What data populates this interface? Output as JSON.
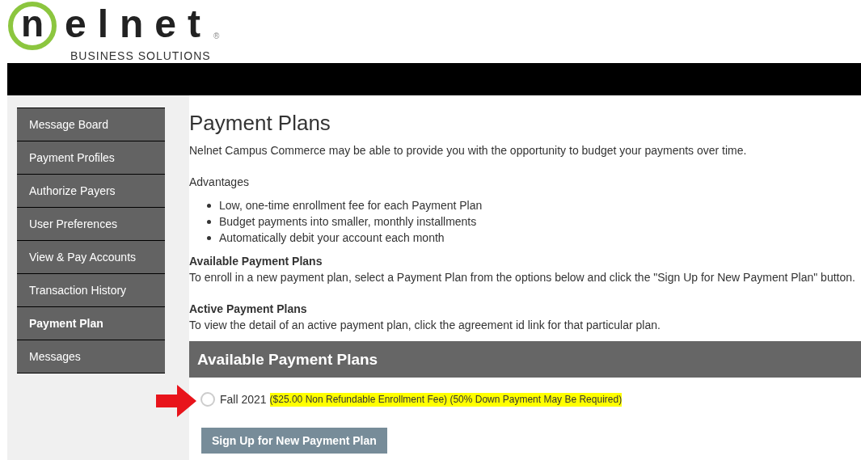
{
  "logo": {
    "circled_letter": "n",
    "rest": "elnet",
    "mark": "®",
    "tagline": "BUSINESS SOLUTIONS"
  },
  "sidebar": {
    "items": [
      {
        "label": "Message Board",
        "selected": false
      },
      {
        "label": "Payment Profiles",
        "selected": false
      },
      {
        "label": "Authorize Payers",
        "selected": false
      },
      {
        "label": "User Preferences",
        "selected": false
      },
      {
        "label": "View & Pay Accounts",
        "selected": false
      },
      {
        "label": "Transaction History",
        "selected": false
      },
      {
        "label": "Payment Plan",
        "selected": true
      },
      {
        "label": "Messages",
        "selected": false
      }
    ]
  },
  "main": {
    "title": "Payment Plans",
    "intro": "Nelnet Campus Commerce may be able to provide you with the opportunity to budget your payments over time.",
    "advantages_heading": "Advantages",
    "advantages": [
      "Low, one-time enrollment fee for each Payment Plan",
      "Budget payments into smaller, monthly installments",
      "Automatically debit your account each month"
    ],
    "sections": [
      {
        "heading": "Available Payment Plans",
        "text": "To enroll in a new payment plan, select a Payment Plan from the options below and click the \"Sign Up for New Payment Plan\" button."
      },
      {
        "heading": "Active Payment Plans",
        "text": "To view the detail of an active payment plan, click the agreement id link for that particular plan."
      }
    ],
    "panel": {
      "title": "Available Payment Plans",
      "plans": [
        {
          "name": "Fall 2021",
          "details": "($25.00 Non Refundable Enrollment Fee) (50% Down Payment May Be Required)",
          "selected": false
        }
      ],
      "button": "Sign Up for New Payment Plan"
    }
  }
}
